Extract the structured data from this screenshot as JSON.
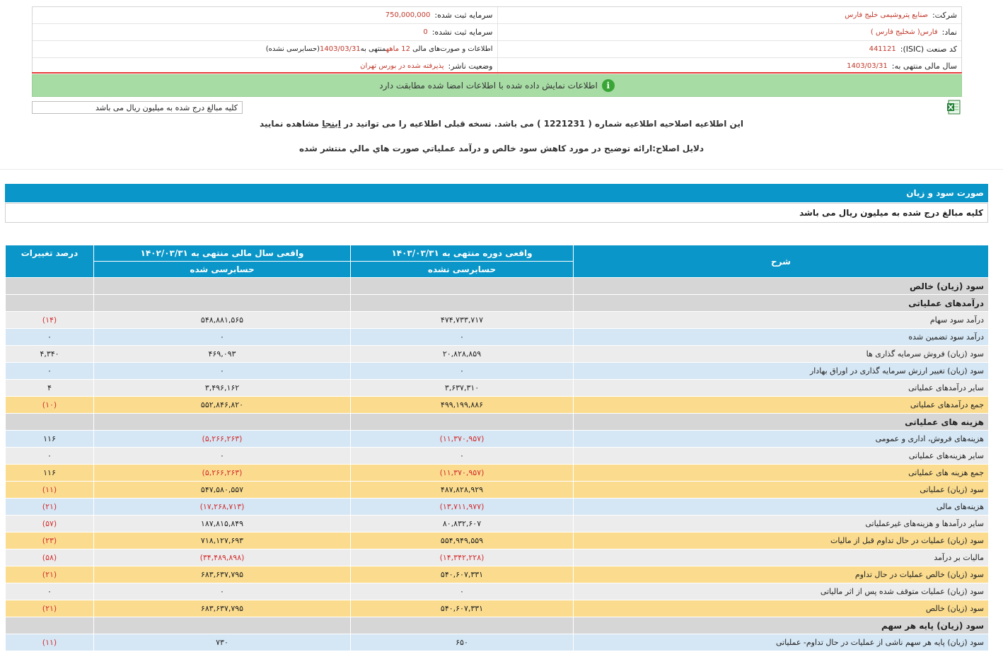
{
  "info": {
    "company_label": "شرکت:",
    "company_value": "صنایع پتروشیمی خلیج فارس",
    "registered_capital_label": "سرمایه ثبت شده:",
    "registered_capital_value": "750,000,000",
    "symbol_label": "نماد:",
    "symbol_value": "فارس( شخلیج فارس )",
    "unregistered_capital_label": "سرمایه ثبت نشده:",
    "unregistered_capital_value": "0",
    "isic_label": "کد صنعت (ISIC):",
    "isic_value": "441121",
    "statements_prefix": "اطلاعات و صورت‌های مالی",
    "statements_period": "12 ماهه",
    "statements_mid": "منتهی به",
    "statements_date": "1403/03/31",
    "statements_suffix": "(حسابرسی نشده)",
    "fiscal_year_label": "سال مالی منتهی به:",
    "fiscal_year_value": "1403/03/31",
    "publisher_status_label": "وضعیت ناشر:",
    "publisher_status_value": "پذیرفته شده در بورس تهران"
  },
  "notice": {
    "icon": "info-icon",
    "text": "اطلاعات نمایش داده شده با اطلاعات امضا شده مطابقت دارد"
  },
  "units_note": "کلیه مبالغ درج شده به میلیون ریال می باشد",
  "amendment": {
    "part1": "این اطلاعیه اصلاحیه اطلاعیه شماره ( 1221231 ) می باشد. نسخه قبلی اطلاعیه را می توانید در ",
    "link": "اینجا",
    "part2": " مشاهده نمایید"
  },
  "reason": "دلایل اصلاح:ارائه توضیح در مورد کاهش سود خالص و درآمد عملیاتي صورت هاي مالي منتشر شده",
  "section": {
    "title": "صورت سود و زیان",
    "units": "کلیه مبالغ درج شده به میلیون ریال می باشد"
  },
  "table": {
    "headers": {
      "desc": "شرح",
      "current": "واقعی دوره منتهی به ۱۴۰۳/۰۳/۳۱",
      "current_sub": "حسابرسی نشده",
      "prior": "واقعی سال مالی منتهی به ۱۴۰۲/۰۳/۳۱",
      "prior_sub": "حسابرسی شده",
      "change": "درصد تغییرات"
    },
    "rows": [
      {
        "style": "head",
        "desc": "سود (زیان) خالص",
        "current": "",
        "prior": "",
        "change": ""
      },
      {
        "style": "head",
        "desc": "درآمدهای عملیاتی",
        "current": "",
        "prior": "",
        "change": ""
      },
      {
        "style": "gray",
        "desc": "درآمد سود سهام",
        "current": "۴۷۴,۷۳۳,۷۱۷",
        "prior": "۵۴۸,۸۸۱,۵۶۵",
        "change": "(۱۴)"
      },
      {
        "style": "blue",
        "desc": "درآمد سود تضمین شده",
        "current": "۰",
        "prior": "۰",
        "change": "۰"
      },
      {
        "style": "gray",
        "desc": "سود (زیان) فروش سرمایه گذاری ها",
        "current": "۲۰,۸۲۸,۸۵۹",
        "prior": "۴۶۹,۰۹۳",
        "change": "۴,۳۴۰"
      },
      {
        "style": "blue",
        "desc": "سود (زیان) تغییر ارزش سرمایه گذاری در اوراق بهادار",
        "current": "۰",
        "prior": "۰",
        "change": "۰"
      },
      {
        "style": "gray",
        "desc": "سایر درآمدهای عملیاتی",
        "current": "۳,۶۳۷,۳۱۰",
        "prior": "۳,۴۹۶,۱۶۲",
        "change": "۴"
      },
      {
        "style": "gold",
        "desc": "جمع درآمدهای عملیاتی",
        "current": "۴۹۹,۱۹۹,۸۸۶",
        "prior": "۵۵۲,۸۴۶,۸۲۰",
        "change": "(۱۰)"
      },
      {
        "style": "head",
        "desc": "هزینه های عملیاتی",
        "current": "",
        "prior": "",
        "change": ""
      },
      {
        "style": "blue",
        "desc": "هزینه‌های فروش، اداری و عمومی",
        "current": "(۱۱,۳۷۰,۹۵۷)",
        "prior": "(۵,۲۶۶,۲۶۳)",
        "change": "۱۱۶"
      },
      {
        "style": "gray",
        "desc": "سایر هزینه‌های عملیاتی",
        "current": "۰",
        "prior": "۰",
        "change": "۰"
      },
      {
        "style": "gold",
        "desc": "جمع هزینه های عملیاتی",
        "current": "(۱۱,۳۷۰,۹۵۷)",
        "prior": "(۵,۲۶۶,۲۶۳)",
        "change": "۱۱۶"
      },
      {
        "style": "gold",
        "desc": "سود (زیان) عملیاتی",
        "current": "۴۸۷,۸۲۸,۹۲۹",
        "prior": "۵۴۷,۵۸۰,۵۵۷",
        "change": "(۱۱)"
      },
      {
        "style": "blue",
        "desc": "هزینه‌های مالی",
        "current": "(۱۳,۷۱۱,۹۷۷)",
        "prior": "(۱۷,۲۶۸,۷۱۳)",
        "change": "(۲۱)"
      },
      {
        "style": "gray",
        "desc": "سایر درآمدها و هزینه‌های غیرعملیاتی",
        "current": "۸۰,۸۳۲,۶۰۷",
        "prior": "۱۸۷,۸۱۵,۸۴۹",
        "change": "(۵۷)"
      },
      {
        "style": "gold",
        "desc": "سود (زیان) عملیات در حال تداوم قبل از مالیات",
        "current": "۵۵۴,۹۴۹,۵۵۹",
        "prior": "۷۱۸,۱۲۷,۶۹۳",
        "change": "(۲۳)"
      },
      {
        "style": "gray",
        "desc": "مالیات بر درآمد",
        "current": "(۱۴,۳۴۲,۲۲۸)",
        "prior": "(۳۴,۴۸۹,۸۹۸)",
        "change": "(۵۸)"
      },
      {
        "style": "gold",
        "desc": "سود (زیان) خالص عملیات در حال تداوم",
        "current": "۵۴۰,۶۰۷,۳۳۱",
        "prior": "۶۸۳,۶۳۷,۷۹۵",
        "change": "(۲۱)"
      },
      {
        "style": "gray",
        "desc": "سود (زیان) عملیات متوقف شده پس از اثر مالیاتی",
        "current": "۰",
        "prior": "۰",
        "change": "۰"
      },
      {
        "style": "gold",
        "desc": "سود (زیان) خالص",
        "current": "۵۴۰,۶۰۷,۳۳۱",
        "prior": "۶۸۳,۶۳۷,۷۹۵",
        "change": "(۲۱)"
      },
      {
        "style": "head",
        "desc": "سود (زیان) پایه هر سهم",
        "current": "",
        "prior": "",
        "change": ""
      },
      {
        "style": "blue",
        "desc": "سود (زیان) پایه هر سهم ناشی از عملیات در حال تداوم- عملیاتی",
        "current": "۶۵۰",
        "prior": "۷۳۰",
        "change": "(۱۱)"
      }
    ]
  }
}
